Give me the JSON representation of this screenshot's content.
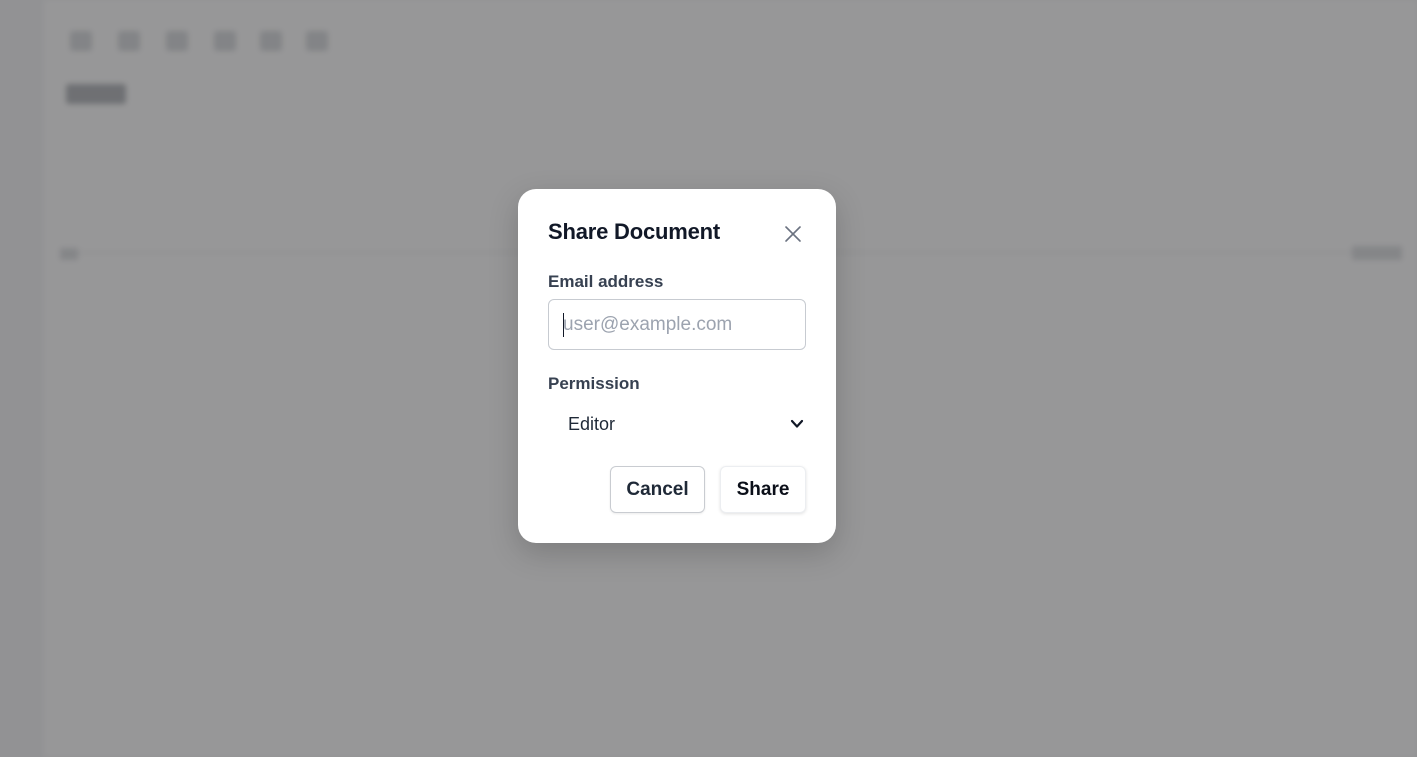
{
  "dialog": {
    "title": "Share Document",
    "email": {
      "label": "Email address",
      "placeholder": "user@example.com",
      "value": ""
    },
    "permission": {
      "label": "Permission",
      "selected": "Editor"
    },
    "buttons": {
      "cancel": "Cancel",
      "share": "Share"
    }
  },
  "icons": {
    "close": "close-icon",
    "chevron": "chevron-down-icon"
  },
  "colors": {
    "overlay": "#4b4b4e",
    "title": "#111827",
    "label": "#374151",
    "placeholder": "#9ca3af"
  }
}
